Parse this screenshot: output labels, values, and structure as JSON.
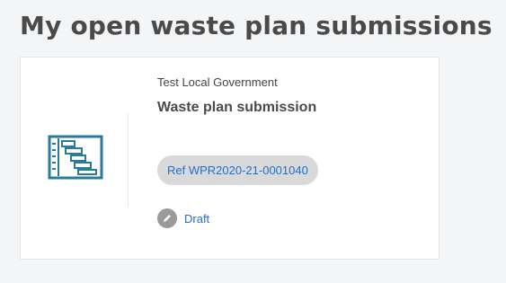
{
  "page": {
    "title": "My open waste plan submissions"
  },
  "submission_card": {
    "organisation": "Test Local Government",
    "title": "Waste plan submission",
    "reference": "Ref WPR2020-21-0001040",
    "status": "Draft",
    "icon": "gantt-chart-icon",
    "status_icon": "pencil-icon"
  },
  "colors": {
    "link": "#1f6fd1",
    "icon": "#2b7a99",
    "badge_bg": "#d9d9d9"
  }
}
